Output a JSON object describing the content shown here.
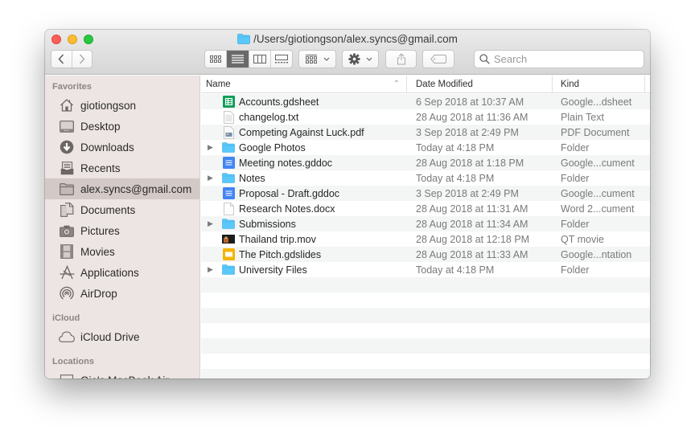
{
  "window": {
    "title": "/Users/giotiongson/alex.syncs@gmail.com"
  },
  "toolbar": {
    "back_icon": "chevron-left-icon",
    "forward_icon": "chevron-right-icon",
    "view_modes": [
      "icon",
      "list",
      "column",
      "gallery"
    ],
    "active_view": "list",
    "search_placeholder": "Search"
  },
  "sidebar": {
    "sections": [
      {
        "title": "Favorites",
        "items": [
          {
            "label": "giotiongson",
            "icon": "home-icon"
          },
          {
            "label": "Desktop",
            "icon": "desktop-icon"
          },
          {
            "label": "Downloads",
            "icon": "downloads-icon"
          },
          {
            "label": "Recents",
            "icon": "recents-icon"
          },
          {
            "label": "alex.syncs@gmail.com",
            "icon": "folder-icon",
            "selected": true
          },
          {
            "label": "Documents",
            "icon": "documents-icon"
          },
          {
            "label": "Pictures",
            "icon": "camera-icon"
          },
          {
            "label": "Movies",
            "icon": "film-icon"
          },
          {
            "label": "Applications",
            "icon": "applications-icon"
          },
          {
            "label": "AirDrop",
            "icon": "airdrop-icon"
          }
        ]
      },
      {
        "title": "iCloud",
        "items": [
          {
            "label": "iCloud Drive",
            "icon": "cloud-icon"
          }
        ]
      },
      {
        "title": "Locations",
        "items": [
          {
            "label": "Gio's MacBook Air",
            "icon": "laptop-icon"
          }
        ]
      }
    ]
  },
  "columns": {
    "name": "Name",
    "date": "Date Modified",
    "kind": "Kind"
  },
  "files": [
    {
      "name": "Accounts.gdsheet",
      "date": "6 Sep 2018 at 10:37 AM",
      "kind": "Google...dsheet",
      "type": "sheet",
      "folder": false
    },
    {
      "name": "changelog.txt",
      "date": "28 Aug 2018 at 11:36 AM",
      "kind": "Plain Text",
      "type": "text",
      "folder": false
    },
    {
      "name": "Competing Against Luck.pdf",
      "date": "3 Sep 2018 at 2:49 PM",
      "kind": "PDF Document",
      "type": "pdf",
      "folder": false
    },
    {
      "name": "Google Photos",
      "date": "Today at 4:18 PM",
      "kind": "Folder",
      "type": "folder",
      "folder": true
    },
    {
      "name": "Meeting notes.gddoc",
      "date": "28 Aug 2018 at 1:18 PM",
      "kind": "Google...cument",
      "type": "doc",
      "folder": false
    },
    {
      "name": "Notes",
      "date": "Today at 4:18 PM",
      "kind": "Folder",
      "type": "folder",
      "folder": true
    },
    {
      "name": "Proposal - Draft.gddoc",
      "date": "3 Sep 2018 at 2:49 PM",
      "kind": "Google...cument",
      "type": "doc",
      "folder": false
    },
    {
      "name": "Research Notes.docx",
      "date": "28 Aug 2018 at 11:31 AM",
      "kind": "Word 2...cument",
      "type": "blank",
      "folder": false
    },
    {
      "name": "Submissions",
      "date": "28 Aug 2018 at 11:34 AM",
      "kind": "Folder",
      "type": "folder",
      "folder": true
    },
    {
      "name": "Thailand trip.mov",
      "date": "28 Aug 2018 at 12:18 PM",
      "kind": "QT movie",
      "type": "movie",
      "folder": false
    },
    {
      "name": "The Pitch.gdslides",
      "date": "28 Aug 2018 at 11:33 AM",
      "kind": "Google...ntation",
      "type": "slides",
      "folder": false
    },
    {
      "name": "University Files",
      "date": "Today at 4:18 PM",
      "kind": "Folder",
      "type": "folder",
      "folder": true
    }
  ],
  "colors": {
    "folder": "#5ac8fa",
    "sheet": "#0f9d58",
    "doc": "#4285f4",
    "slides": "#f4b400",
    "sidebar_bg": "#ede5e3",
    "sidebar_selected": "#d3c9c7"
  }
}
